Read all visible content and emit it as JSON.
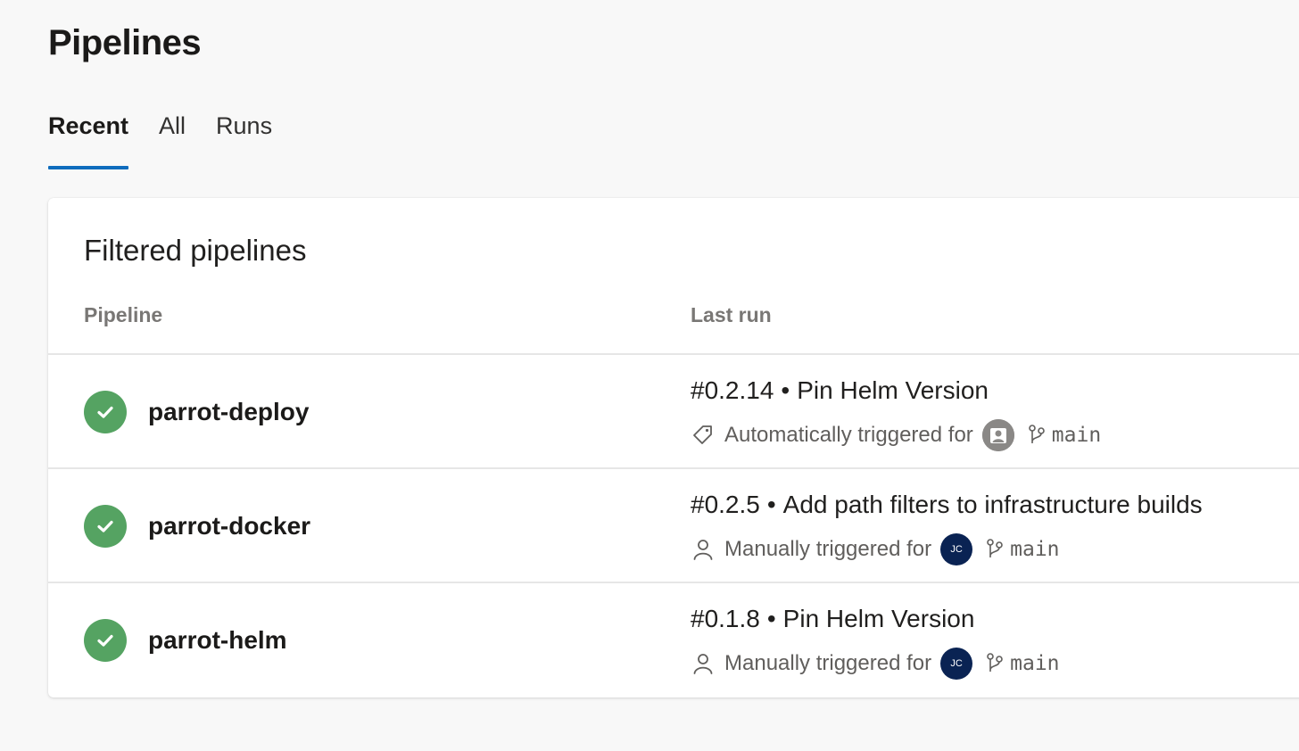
{
  "page": {
    "title": "Pipelines"
  },
  "tabs": [
    {
      "label": "Recent",
      "active": true
    },
    {
      "label": "All",
      "active": false
    },
    {
      "label": "Runs",
      "active": false
    }
  ],
  "card": {
    "title": "Filtered pipelines",
    "columns": {
      "pipeline": "Pipeline",
      "last_run": "Last run"
    }
  },
  "pipelines": [
    {
      "name": "parrot-deploy",
      "status": "succeeded",
      "run_number": "#0.2.14",
      "run_message": "Pin Helm Version",
      "trigger_icon": "tag-icon",
      "trigger_text": "Automatically triggered for",
      "avatar_initials": "",
      "avatar_type": "default-user-avatar",
      "branch": "main"
    },
    {
      "name": "parrot-docker",
      "status": "succeeded",
      "run_number": "#0.2.5",
      "run_message": "Add path filters to infrastructure builds",
      "trigger_icon": "person-icon",
      "trigger_text": "Manually triggered for",
      "avatar_initials": "JC",
      "avatar_type": "initials-avatar",
      "branch": "main"
    },
    {
      "name": "parrot-helm",
      "status": "succeeded",
      "run_number": "#0.1.8",
      "run_message": "Pin Helm Version",
      "trigger_icon": "person-icon",
      "trigger_text": "Manually triggered for",
      "avatar_initials": "JC",
      "avatar_type": "initials-avatar",
      "branch": "main"
    }
  ],
  "separator": "•",
  "colors": {
    "success": "#55a362",
    "accent": "#0f6cbd",
    "avatar_dark": "#0a2353"
  }
}
